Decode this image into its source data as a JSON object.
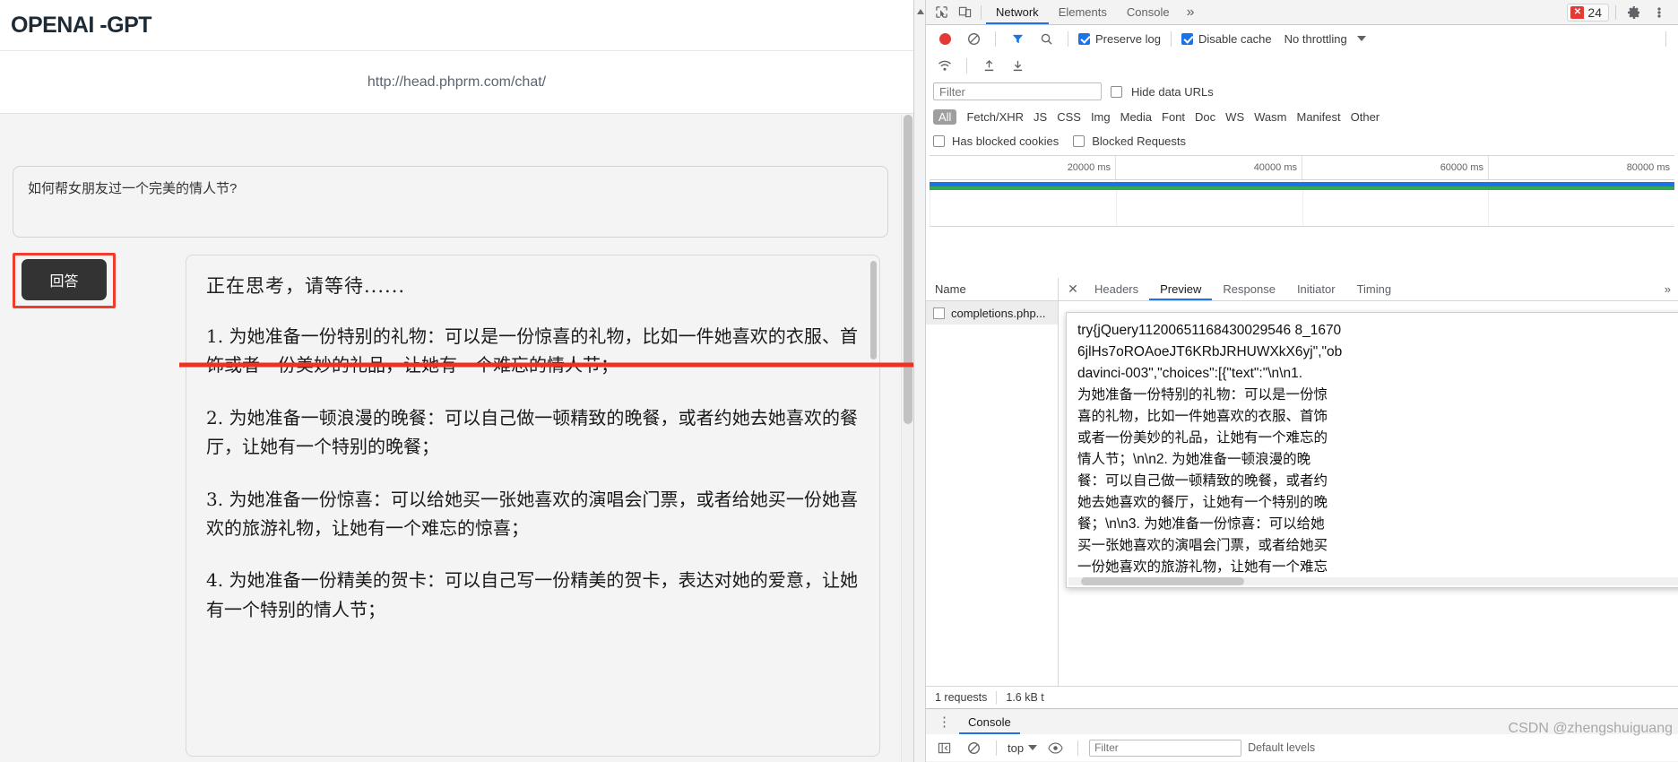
{
  "webpage": {
    "brand_title": "OPENAI -GPT",
    "url": "http://head.phprm.com/chat/",
    "prompt_value": "如何帮女朋友过一个完美的情人节?",
    "prompt_placeholder": "",
    "ask_button_label": "回答",
    "result": {
      "thinking": "正在思考，请等待......",
      "items": [
        "1. 为她准备一份特别的礼物：可以是一份惊喜的礼物，比如一件她喜欢的衣服、首饰或者一份美妙的礼品，让她有一个难忘的情人节；",
        "2. 为她准备一顿浪漫的晚餐：可以自己做一顿精致的晚餐，或者约她去她喜欢的餐厅，让她有一个特别的晚餐；",
        "3. 为她准备一份惊喜：可以给她买一张她喜欢的演唱会门票，或者给她买一份她喜欢的旅游礼物，让她有一个难忘的惊喜；",
        "4. 为她准备一份精美的贺卡：可以自己写一份精美的贺卡，表达对她的爱意，让她有一个特别的情人节；"
      ]
    }
  },
  "devtools": {
    "tabs": [
      {
        "label": "Network",
        "active": true
      },
      {
        "label": "Elements",
        "active": false
      },
      {
        "label": "Console",
        "active": false
      }
    ],
    "more_tabs_glyph": "»",
    "error_count": "24",
    "icons": {
      "inspect": "inspect-element-icon",
      "device": "device-toolbar-icon",
      "record": "record-icon",
      "clear": "clear-icon",
      "filter": "filter-icon",
      "search": "search-icon",
      "settings": "gear-icon",
      "kebab": "more-options-icon",
      "import": "import-har-icon",
      "export": "export-har-icon",
      "wifi": "network-conditions-icon"
    },
    "network_toolbar": {
      "preserve_log": {
        "label": "Preserve log",
        "checked": true
      },
      "disable_cache": {
        "label": "Disable cache",
        "checked": true
      },
      "throttling": "No throttling"
    },
    "filter": {
      "placeholder": "Filter",
      "value": "",
      "hide_data_urls": {
        "label": "Hide data URLs",
        "checked": false
      }
    },
    "resource_types": [
      {
        "label": "All",
        "active": true
      },
      {
        "label": "Fetch/XHR",
        "active": false
      },
      {
        "label": "JS",
        "active": false
      },
      {
        "label": "CSS",
        "active": false
      },
      {
        "label": "Img",
        "active": false
      },
      {
        "label": "Media",
        "active": false
      },
      {
        "label": "Font",
        "active": false
      },
      {
        "label": "Doc",
        "active": false
      },
      {
        "label": "WS",
        "active": false
      },
      {
        "label": "Wasm",
        "active": false
      },
      {
        "label": "Manifest",
        "active": false
      },
      {
        "label": "Other",
        "active": false
      }
    ],
    "blocked_filters": [
      {
        "label": "Has blocked cookies",
        "checked": false
      },
      {
        "label": "Blocked Requests",
        "checked": false
      }
    ],
    "timeline_ticks": [
      "20000 ms",
      "40000 ms",
      "60000 ms",
      "80000 ms"
    ],
    "request_table": {
      "column_name": "Name",
      "rows": [
        {
          "name": "completions.php..."
        }
      ]
    },
    "detail_tabs": [
      {
        "label": "Headers",
        "active": false
      },
      {
        "label": "Preview",
        "active": true
      },
      {
        "label": "Response",
        "active": false
      },
      {
        "label": "Initiator",
        "active": false
      },
      {
        "label": "Timing",
        "active": false
      }
    ],
    "detail_more_glyph": "»",
    "close_glyph": "✕",
    "preview_text": "try{jQuery11200651168430029546 8_1670\n6jlHs7oROAoeJT6KRbJRHUWXkX6yj\",\"ob\ndavinci-003\",\"choices\":[{\"text\":\"\\n\\n1.\n为她准备一份特别的礼物：可以是一份惊\n喜的礼物，比如一件她喜欢的衣服、首饰\n或者一份美妙的礼品，让她有一个难忘的\n情人节；\\n\\n2. 为她准备一顿浪漫的晚\n餐：可以自己做一顿精致的晚餐，或者约\n她去她喜欢的餐厅，让她有一个特别的晚\n餐；\\n\\n3. 为她准备一份惊喜：可以给她\n买一张她喜欢的演唱会门票，或者给她买\n一份她喜欢的旅游礼物，让她有一个难忘",
    "status_bar": {
      "requests": "1 requests",
      "transferred": "1.6 kB t"
    },
    "console_drawer": {
      "tab_label": "Console",
      "context": "top",
      "filter_placeholder": "Filter",
      "levels": "Default levels"
    }
  },
  "watermark": "CSDN @zhengshuiguang",
  "colors": {
    "accent_blue": "#1a73e8",
    "error_red": "#e53935",
    "highlight_red": "#f03c2e",
    "button_dark": "#333333",
    "waterfall_green": "#34a853"
  }
}
